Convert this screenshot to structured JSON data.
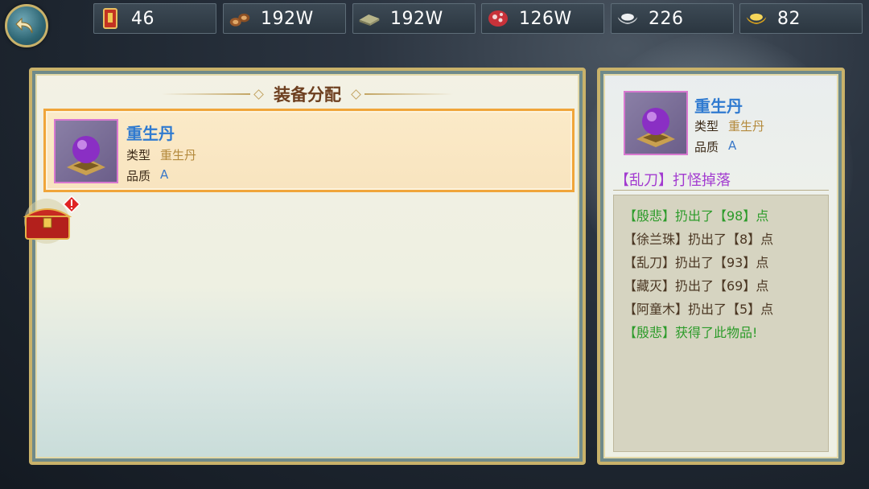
{
  "hud": {
    "resources": [
      {
        "name": "token",
        "icon": "scroll-token-icon",
        "value": "46"
      },
      {
        "name": "wood",
        "icon": "wood-logs-icon",
        "value": "192W"
      },
      {
        "name": "stone",
        "icon": "stone-slab-icon",
        "value": "192W"
      },
      {
        "name": "meat",
        "icon": "meat-icon",
        "value": "126W"
      },
      {
        "name": "silver",
        "icon": "silver-ingot-icon",
        "value": "226"
      },
      {
        "name": "gold",
        "icon": "gold-ingot-icon",
        "value": "82"
      }
    ]
  },
  "left_panel": {
    "title": "装备分配",
    "item": {
      "name": "重生丹",
      "type_label": "类型",
      "type_value": "重生丹",
      "quality_label": "品质",
      "quality_value": "A"
    }
  },
  "right_panel": {
    "item": {
      "name": "重生丹",
      "type_label": "类型",
      "type_value": "重生丹",
      "quality_label": "品质",
      "quality_value": "A"
    },
    "drop_source": "【乱刀】打怪掉落",
    "log": [
      {
        "text": "【殷悲】扔出了【98】点",
        "color": "green"
      },
      {
        "text": "【徐兰珠】扔出了【8】点",
        "color": "brown"
      },
      {
        "text": "【乱刀】扔出了【93】点",
        "color": "brown"
      },
      {
        "text": "【藏灭】扔出了【69】点",
        "color": "brown"
      },
      {
        "text": "【阿童木】扔出了【5】点",
        "color": "brown"
      },
      {
        "text": "【殷悲】获得了此物品!",
        "color": "green"
      }
    ]
  },
  "colors": {
    "accent_gold": "#c9b26a",
    "item_name_blue": "#2f7ad0",
    "drop_purple": "#a23bd0",
    "log_green": "#2c9b2a"
  }
}
